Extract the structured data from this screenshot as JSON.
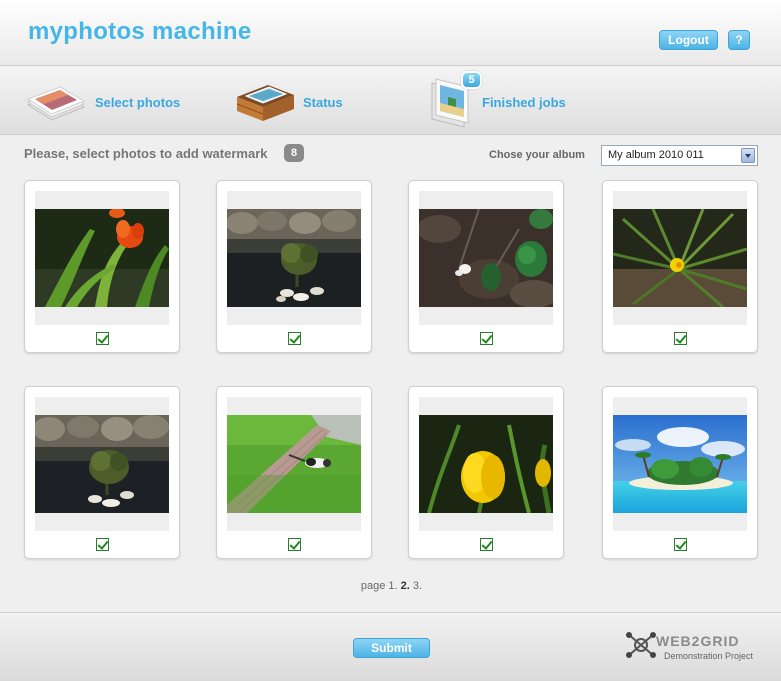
{
  "header": {
    "logo": "myphotos machine",
    "logout_label": "Logout",
    "help_label": "?"
  },
  "nav": {
    "items": [
      {
        "label": "Select photos",
        "icon": "photo-stack-icon"
      },
      {
        "label": "Status",
        "icon": "tray-icon"
      },
      {
        "label": "Finished jobs",
        "icon": "photo-stack-icon",
        "badge": "5"
      }
    ]
  },
  "selection": {
    "instruction": "Please, select photos to add watermark",
    "count": "8",
    "album_label": "Chose your album",
    "album_value": "My album 2010 011"
  },
  "photos": [
    {
      "subject": "red tulips",
      "checked": true
    },
    {
      "subject": "pond with plants",
      "checked": true
    },
    {
      "subject": "white flower on ground",
      "checked": true
    },
    {
      "subject": "yellow flower in grass",
      "checked": true
    },
    {
      "subject": "pond with plants",
      "checked": true
    },
    {
      "subject": "cat on garden path",
      "checked": true
    },
    {
      "subject": "yellow tulip",
      "checked": true
    },
    {
      "subject": "tropical island",
      "checked": true
    }
  ],
  "pager": {
    "prefix": "page",
    "pages": [
      "1.",
      "2.",
      "3."
    ],
    "current": "2."
  },
  "footer": {
    "submit_label": "Submit",
    "brand": "WEB2GRID",
    "brand_sub": "Demonstration Project"
  },
  "colors": {
    "accent": "#45b6e8",
    "button": "#4cb3e6",
    "check": "#1d8a1d"
  }
}
